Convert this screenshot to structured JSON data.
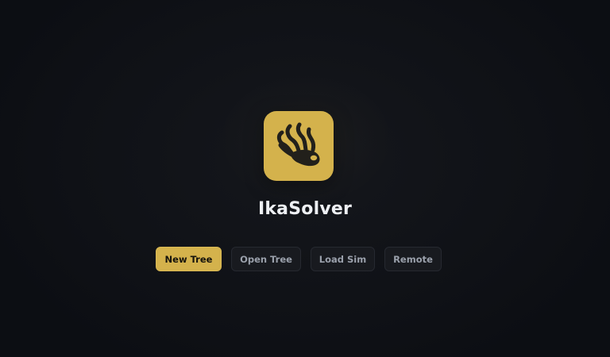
{
  "app": {
    "title": "IkaSolver",
    "logo_icon": "squid-tentacles-icon"
  },
  "colors": {
    "accent": "#d4b24c",
    "background": "#0c0e13",
    "title_text": "#eef0f4",
    "secondary_button_bg": "#181a1f",
    "secondary_button_text": "#9aa0ab"
  },
  "actions": {
    "new_tree_label": "New Tree",
    "open_tree_label": "Open Tree",
    "load_sim_label": "Load Sim",
    "remote_label": "Remote"
  }
}
